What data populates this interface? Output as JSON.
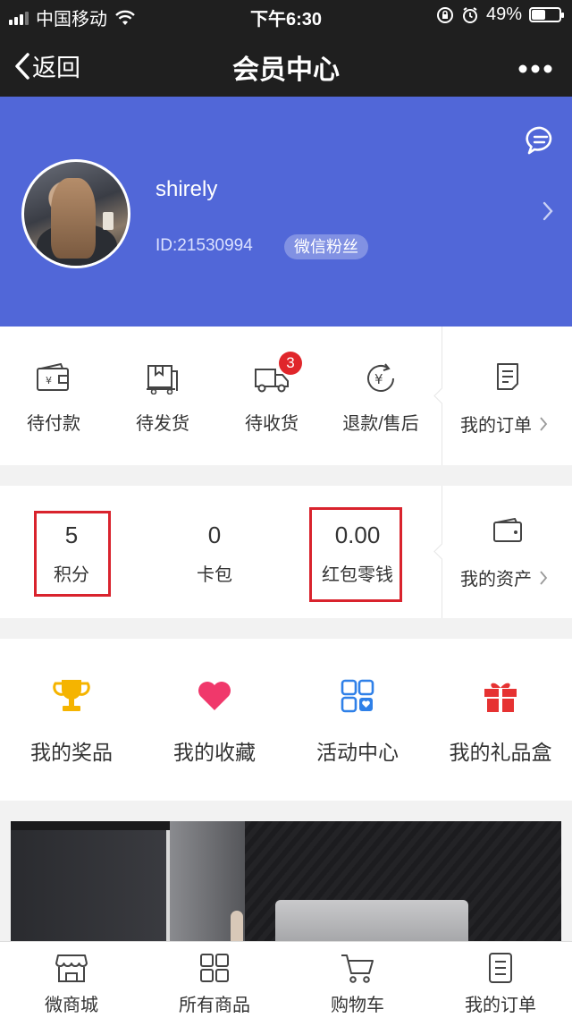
{
  "status_bar": {
    "carrier": "中国移动",
    "time": "下午6:30",
    "battery": "49%",
    "battery_level": 0.49
  },
  "navbar": {
    "back_label": "返回",
    "title": "会员中心"
  },
  "profile": {
    "username": "shirely",
    "user_id": "ID:21530994",
    "tag": "微信粉丝"
  },
  "orders": {
    "items": [
      {
        "label": "待付款",
        "icon": "wallet-icon"
      },
      {
        "label": "待发货",
        "icon": "package-icon"
      },
      {
        "label": "待收货",
        "icon": "truck-icon",
        "badge": "3"
      },
      {
        "label": "退款/售后",
        "icon": "refund-icon"
      }
    ],
    "my_orders_label": "我的订单"
  },
  "assets": {
    "items": [
      {
        "value": "5",
        "label": "积分"
      },
      {
        "value": "0",
        "label": "卡包"
      },
      {
        "value": "0.00",
        "label": "红包零钱"
      }
    ],
    "my_assets_label": "我的资产"
  },
  "features": [
    {
      "label": "我的奖品",
      "icon": "trophy-icon",
      "color": "#f5b400"
    },
    {
      "label": "我的收藏",
      "icon": "heart-icon",
      "color": "#f0386b"
    },
    {
      "label": "活动中心",
      "icon": "grid-heart-icon",
      "color": "#2f80e8"
    },
    {
      "label": "我的礼品盒",
      "icon": "gift-icon",
      "color": "#e63232"
    }
  ],
  "tabbar": [
    {
      "label": "微商城",
      "icon": "shop-icon"
    },
    {
      "label": "所有商品",
      "icon": "grid-icon"
    },
    {
      "label": "购物车",
      "icon": "cart-icon"
    },
    {
      "label": "我的订单",
      "icon": "order-icon"
    }
  ],
  "colors": {
    "header_bg": "#1f1f1f",
    "profile_bg": "#5167d8",
    "badge_red": "#e0262b",
    "highlight_red": "#d9232d"
  }
}
